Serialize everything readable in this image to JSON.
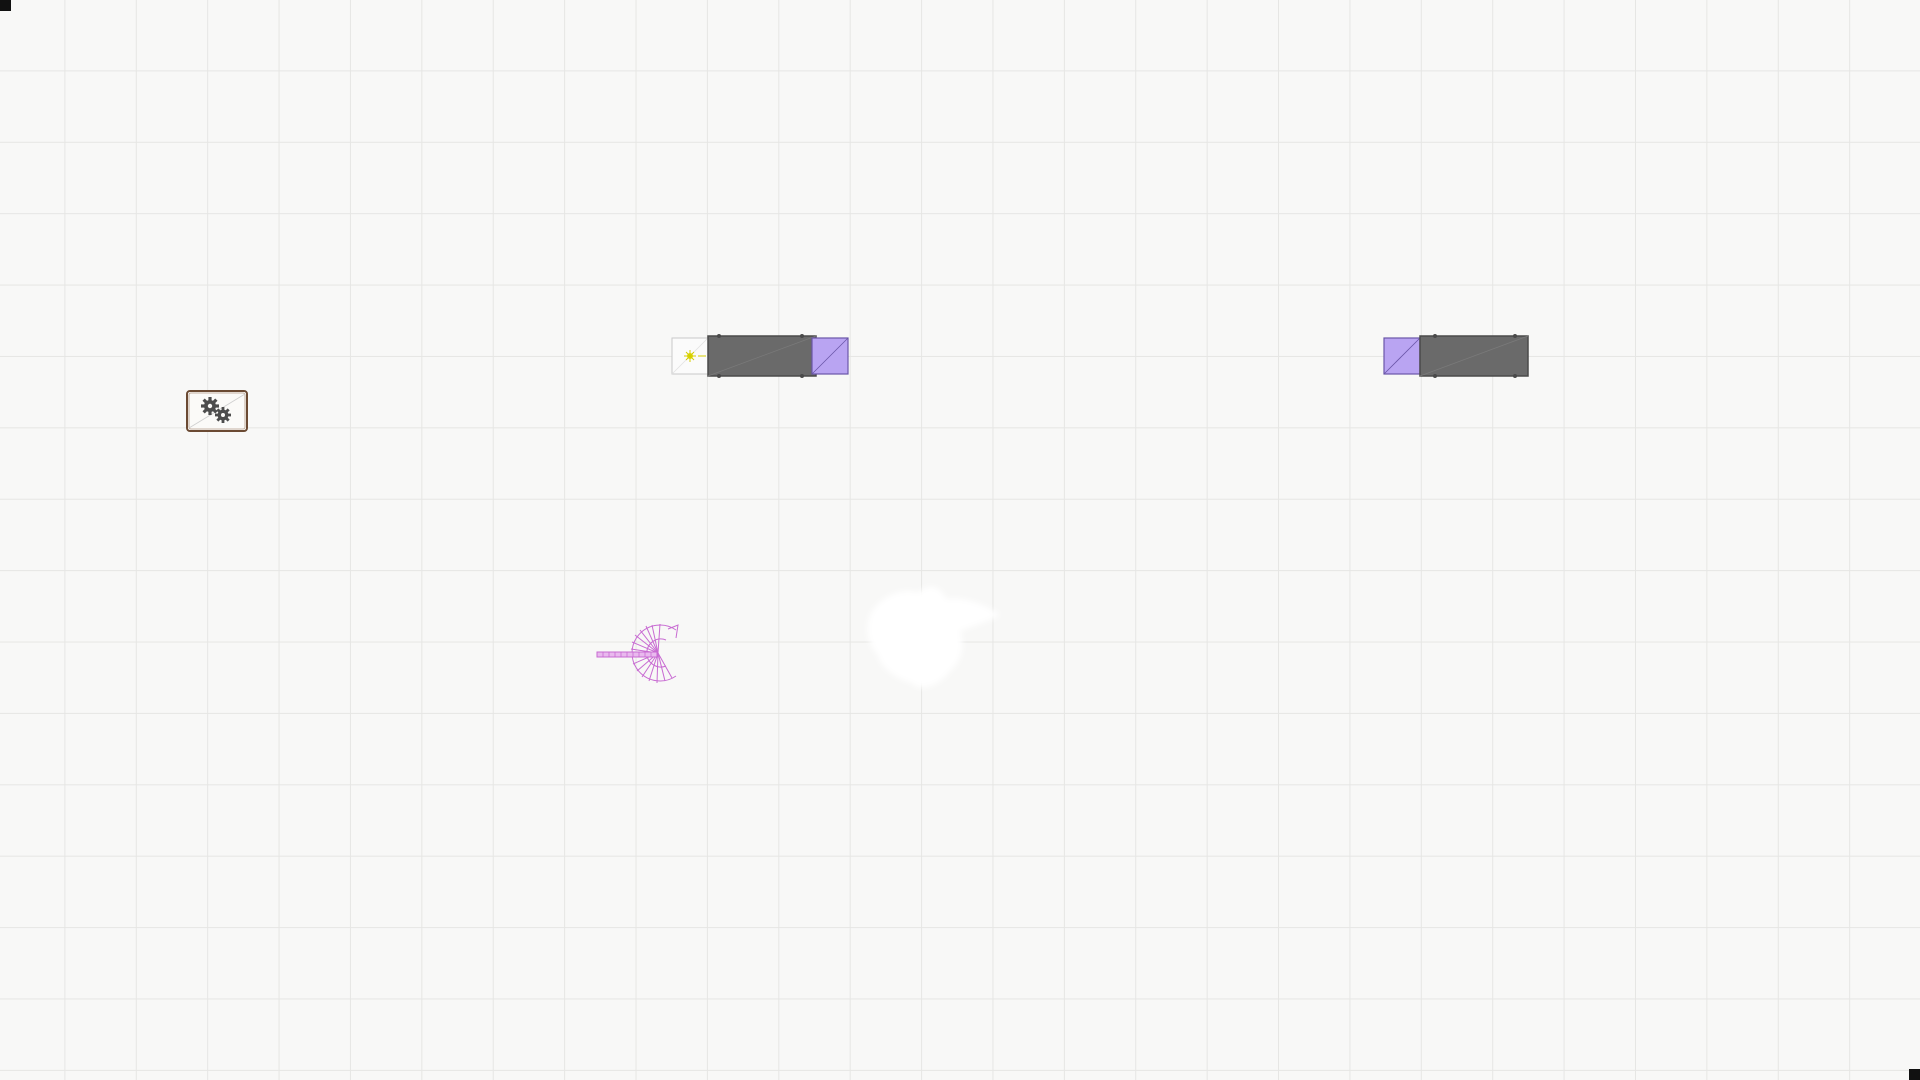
{
  "canvas": {
    "background_color": "#f8f8f7",
    "grid_color": "#e6e6e4",
    "grid": true
  },
  "components": [
    {
      "name": "control-panel",
      "icon": "gears-icon",
      "colors": {
        "frame": "#6b4a33",
        "gear": "#4a4a4a"
      }
    },
    {
      "name": "conveyor-with-light-source",
      "icons": [
        "light-source-icon",
        "conveyor-belt-icon",
        "end-block-icon"
      ],
      "colors": {
        "belt": "#6a6a6a",
        "block": "#b9a4f2",
        "light": "#e6e000"
      }
    },
    {
      "name": "conveyor",
      "icons": [
        "end-block-icon",
        "conveyor-belt-icon"
      ],
      "colors": {
        "belt": "#6a6a6a",
        "block": "#b9a4f2"
      }
    },
    {
      "name": "spiral-staircase",
      "icon": "spiral-staircase-icon",
      "colors": {
        "stroke": "#c86bd2"
      }
    },
    {
      "name": "white-blob",
      "icon": "blob-shape",
      "colors": {
        "fill": "#ffffff"
      }
    }
  ]
}
